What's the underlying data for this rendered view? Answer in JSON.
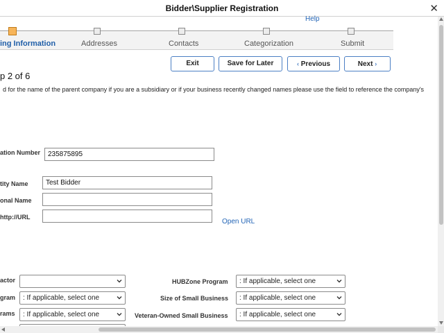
{
  "window": {
    "title": "Bidder\\Supplier Registration",
    "close_glyph": "✕"
  },
  "help_link": "Help",
  "steps": [
    {
      "label": "ing Information",
      "active": true
    },
    {
      "label": "Addresses",
      "active": false
    },
    {
      "label": "Contacts",
      "active": false
    },
    {
      "label": "Categorization",
      "active": false
    },
    {
      "label": "Submit",
      "active": false
    }
  ],
  "buttons": {
    "exit": "Exit",
    "save_for_later": "Save for Later",
    "previous": "Previous",
    "next": "Next"
  },
  "step_count": "p 2 of 6",
  "info_text": "d for the name of the parent company if you are a subsidiary or if your business recently changed names please use the field to reference the company's",
  "fields": {
    "id_number": {
      "label": "ation Number",
      "value": "235875895"
    },
    "entity_name": {
      "label": "tity Name",
      "value": "Test Bidder"
    },
    "additional_name": {
      "label": "onal Name",
      "value": ""
    },
    "url": {
      "label": "http://URL",
      "value": ""
    }
  },
  "open_url": "Open URL",
  "selects_left": [
    {
      "label": "actor",
      "value": ""
    },
    {
      "label": "gram",
      "value": ": If applicable, select one"
    },
    {
      "label": "rams",
      "value": ": If applicable, select one"
    }
  ],
  "selects_right": [
    {
      "label": "HUBZone Program",
      "value": ": If applicable, select one"
    },
    {
      "label": "Size of Small Business",
      "value": ": If applicable, select one"
    },
    {
      "label": "Veteran-Owned Small Business",
      "value": ": If applicable, select one"
    }
  ],
  "icons": {
    "close": "close-icon",
    "chevron_left": "chevron-left-icon",
    "chevron_right": "chevron-right-icon",
    "caret_down": "chevron-down-icon"
  },
  "colors": {
    "accent": "#4b7fc4",
    "link": "#2264b6",
    "active_step": "#f7b55a"
  }
}
